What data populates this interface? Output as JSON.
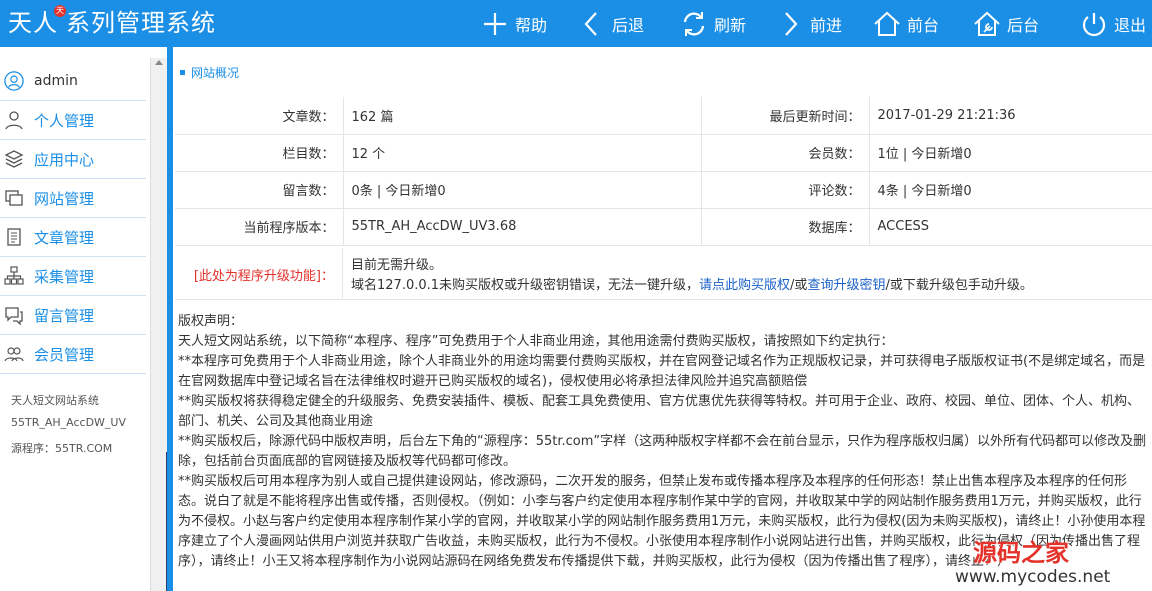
{
  "header": {
    "title": "天人",
    "title_badge": "天",
    "title_rest": "系列管理系统",
    "nav": [
      {
        "label": "帮助",
        "icon": "plus-icon"
      },
      {
        "label": "后退",
        "icon": "chevron-left-icon"
      },
      {
        "label": "刷新",
        "icon": "refresh-icon"
      },
      {
        "label": "前进",
        "icon": "chevron-right-icon"
      },
      {
        "label": "前台",
        "icon": "home-icon"
      },
      {
        "label": "后台",
        "icon": "wrench-house-icon"
      },
      {
        "label": "退出",
        "icon": "power-icon"
      }
    ]
  },
  "sidebar": {
    "user": "admin",
    "items": [
      {
        "label": "个人管理",
        "icon": "user-icon"
      },
      {
        "label": "应用中心",
        "icon": "layers-icon"
      },
      {
        "label": "网站管理",
        "icon": "windows-icon"
      },
      {
        "label": "文章管理",
        "icon": "document-icon"
      },
      {
        "label": "采集管理",
        "icon": "sitemap-icon"
      },
      {
        "label": "留言管理",
        "icon": "chat-icon"
      },
      {
        "label": "会员管理",
        "icon": "users-icon"
      }
    ],
    "info": [
      "天人短文网站系统",
      "55TR_AH_AccDW_UV",
      "源程序：55TR.COM"
    ]
  },
  "main": {
    "section_title": "网站概况",
    "rows": [
      {
        "k1": "文章数：",
        "v1": "162 篇",
        "k2": "最后更新时间：",
        "v2": "2017-01-29 21:21:36"
      },
      {
        "k1": "栏目数：",
        "v1": "12 个",
        "k2": "会员数：",
        "v2": "1位 | 今日新增0"
      },
      {
        "k1": "留言数：",
        "v1": "0条 | 今日新增0",
        "k2": "评论数：",
        "v2": "4条 | 今日新增0"
      },
      {
        "k1": "当前程序版本：",
        "v1": "55TR_AH_AccDW_UV3.68",
        "k2": "数据库：",
        "v2": "ACCESS"
      }
    ],
    "upgrade": {
      "label": "[此处为程序升级功能]：",
      "line1": "目前无需升级。",
      "line2_a": "域名127.0.0.1未购买版权或升级密钥错误，无法一键升级，",
      "link1": "请点此购买版权",
      "line2_b": "/或",
      "link2": "查询升级密钥",
      "line2_c": "/或下载升级包手动升级。"
    },
    "copyright": [
      "版权声明：",
      "天人短文网站系统，以下简称“本程序、程序”可免费用于个人非商业用途，其他用途需付费购买版权，请按照如下约定执行：",
      "**本程序可免费用于个人非商业用途，除个人非商业外的用途均需要付费购买版权，并在官网登记域名作为正规版权记录，并可获得电子版版权证书(不是绑定域名，而是在官网数据库中登记域名旨在法律维权时避开已购买版权的域名)，侵权使用必将承担法律风险并追究高额赔偿",
      "**购买版权将获得稳定健全的升级服务、免费安装插件、模板、配套工具免费使用、官方优惠优先获得等特权。并可用于企业、政府、校园、单位、团体、个人、机构、部门、机关、公司及其他商业用途",
      "**购买版权后，除源代码中版权声明，后台左下角的“源程序：55tr.com”字样（这两种版权字样都不会在前台显示，只作为程序版权归属）以外所有代码都可以修改及删除，包括前台页面底部的官网链接及版权等代码都可修改。",
      "**购买版权后可用本程序为别人或自己提供建设网站，修改源码，二次开发的服务，但禁止发布或传播本程序及本程序的任何形态！禁止出售本程序及本程序的任何形态。说白了就是不能将程序出售或传播，否则侵权。（例如：小李与客户约定使用本程序制作某中学的官网，并收取某中学的网站制作服务费用1万元，并购买版权，此行为不侵权。小赵与客户约定使用本程序制作某小学的官网，并收取某小学的网站制作服务费用1万元，未购买版权，此行为侵权(因为未购买版权)，请终止！小孙使用本程序建立了个人漫画网站供用户浏览并获取广告收益，未购买版权，此行为不侵权。小张使用本程序制作小说网站进行出售，并购买版权，此行为侵权（因为传播出售了程序），请终止！小王又将本程序制作为小说网站源码在网络免费发布传播提供下载，并购买版权，此行为侵权（因为传播出售了程序），请终止！）"
    ]
  },
  "watermark": {
    "big": "源码之家",
    "small": "www.mycodes.net"
  },
  "colors": {
    "header_bg": "#1b8fe6",
    "link": "#1b62c9",
    "warning": "#e4322b"
  }
}
